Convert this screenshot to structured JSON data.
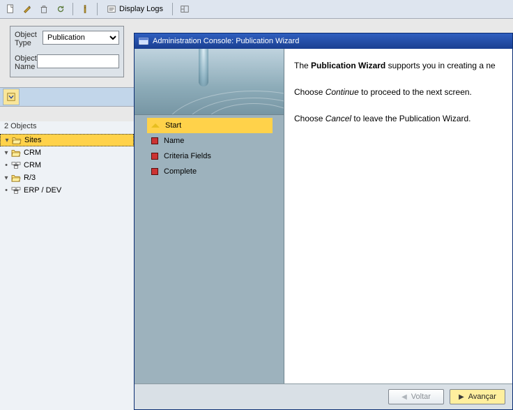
{
  "toolbar": {
    "display_logs": "Display Logs"
  },
  "filter": {
    "object_type_label": "Object Type",
    "object_type_value": "Publication",
    "object_name_label": "Object Name",
    "object_name_value": ""
  },
  "tree": {
    "header": "2 Objects",
    "nodes": [
      {
        "label": "Sites",
        "children": [
          {
            "label": "CRM",
            "children": [
              {
                "label": "CRM"
              }
            ]
          },
          {
            "label": "R/3",
            "children": [
              {
                "label": "ERP / DEV"
              }
            ]
          }
        ]
      }
    ]
  },
  "wizard": {
    "title": "Administration Console: Publication Wizard",
    "steps": [
      "Start",
      "Name",
      "Criteria Fields",
      "Complete"
    ],
    "text": {
      "intro_a": "The",
      "intro_bold": "Publication Wizard",
      "intro_b": "supports you in creating a ne",
      "cont_a": "Choose",
      "cont_em": "Continue",
      "cont_b": "to proceed to the next screen.",
      "canc_a": "Choose",
      "canc_em": "Cancel",
      "canc_b": "to leave the Publication Wizard."
    },
    "buttons": {
      "back": "Voltar",
      "next": "Avançar"
    }
  }
}
